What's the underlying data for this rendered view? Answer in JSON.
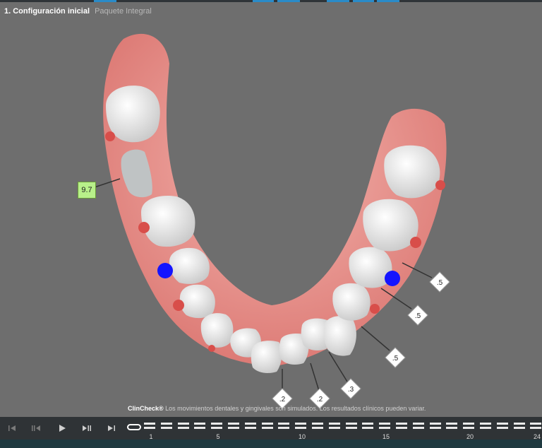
{
  "header": {
    "title": "1. Configuración inicial",
    "package": "Paquete Integral"
  },
  "labels": {
    "green_badge": "9.7",
    "r1": ".5",
    "r2": ".5",
    "r3": ".5",
    "b1": ".2",
    "b2": ".2",
    "b3": ".3"
  },
  "disclaimer": {
    "brand": "ClinCheck®",
    "text": "Los movimientos dentales y gingivales son simulados. Los resultados clínicos pueden variar."
  },
  "timeline": {
    "numbers": [
      "1",
      "5",
      "10",
      "15",
      "20",
      "24"
    ]
  },
  "controls": {
    "first": "first-stage",
    "prev": "previous-stage",
    "play": "play",
    "next": "next-stage",
    "last": "last-stage"
  },
  "colors": {
    "gum": "#e58b86",
    "tooth": "#f2f2f2",
    "attachment": "#1414ff",
    "background": "#6e6e6e",
    "accent": "#2a8bc8"
  }
}
